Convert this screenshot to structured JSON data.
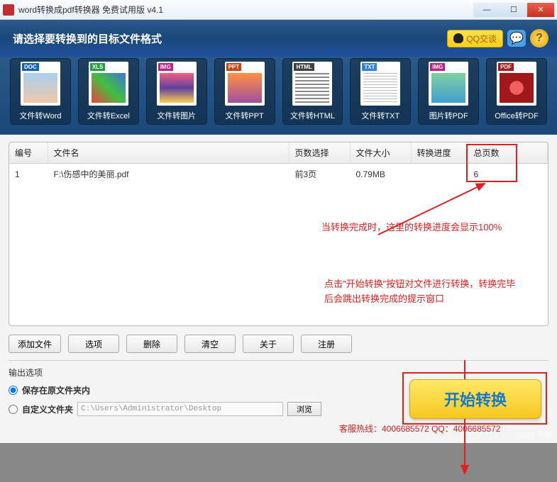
{
  "window": {
    "title": "word转换成pdf转换器 免费试用版 v4.1"
  },
  "header": {
    "title": "请选择要转换到的目标文件格式",
    "qq_label": "QQ交谈"
  },
  "formats": [
    {
      "tag": "DOC",
      "label": "文件转Word"
    },
    {
      "tag": "XLS",
      "label": "文件转Excel"
    },
    {
      "tag": "IMG",
      "label": "文件转图片"
    },
    {
      "tag": "PPT",
      "label": "文件转PPT"
    },
    {
      "tag": "HTML",
      "label": "文件转HTML"
    },
    {
      "tag": "TXT",
      "label": "文件转TXT"
    },
    {
      "tag": "IMG",
      "label": "图片转PDF"
    },
    {
      "tag": "PDF",
      "label": "Office转PDF"
    }
  ],
  "table": {
    "headers": {
      "no": "编号",
      "name": "文件名",
      "pages": "页数选择",
      "size": "文件大小",
      "progress": "转换进度",
      "total": "总页数"
    },
    "rows": [
      {
        "no": "1",
        "name": "F:\\伤感中的美丽.pdf",
        "pages": "前3页",
        "size": "0.79MB",
        "progress": "",
        "total": "6"
      }
    ]
  },
  "annotations": {
    "progress_note": "当转换完成时，这里的转换进度会显示100%",
    "start_note": "点击\"开始转换\"按钮对文件进行转换，转换完毕后会跳出转换完成的提示窗口"
  },
  "buttons": {
    "add": "添加文件",
    "options": "选项",
    "delete": "删除",
    "clear": "清空",
    "about": "关于",
    "register": "注册",
    "start": "开始转换",
    "browse": "浏览"
  },
  "output": {
    "section_title": "输出选项",
    "save_same_folder": "保存在原文件夹内",
    "custom_folder": "自定义文件夹",
    "path": "C:\\Users\\Administrator\\Desktop"
  },
  "footer": {
    "hotline": "客服热线：4006685572 QQ：4006685572"
  },
  "watermark": "9553下载"
}
